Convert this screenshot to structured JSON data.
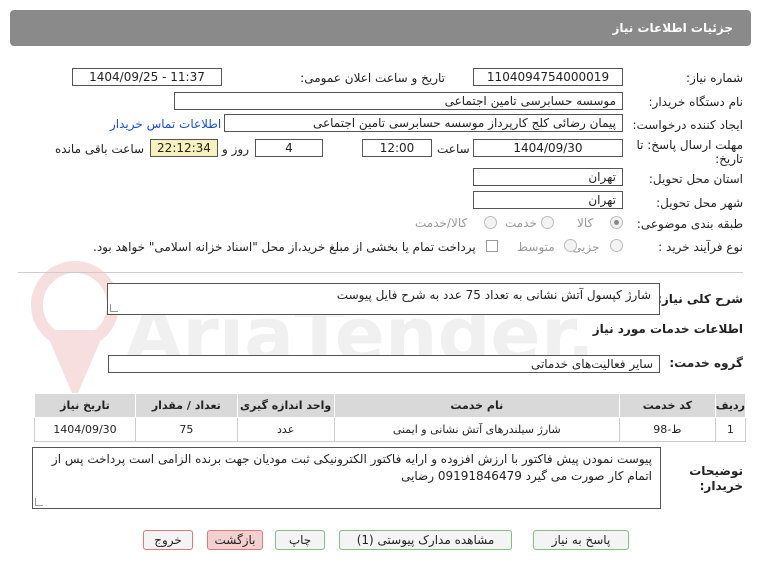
{
  "header": {
    "title": "جزئیات اطلاعات نیاز"
  },
  "form": {
    "need_number_label": "شماره نیاز:",
    "need_number": "1104094754000019",
    "announce_label": "تاریخ و ساعت اعلان عمومی:",
    "announce_value": "1404/09/25 - 11:37",
    "buyer_org_label": "نام دستگاه خریدار:",
    "buyer_org": "موسسه حسابرسی تامین اجتماعی",
    "requester_label": "ایجاد کننده درخواست:",
    "requester": "پیمان رضائی کلج کارپرداز موسسه حسابرسی تامین اجتماعی",
    "contact_link": "اطلاعات تماس خریدار",
    "deadline_label_1": "مهلت ارسال پاسخ: تا",
    "deadline_label_2": "تاریخ:",
    "deadline_date": "1404/09/30",
    "time_label": "ساعت",
    "deadline_time": "12:00",
    "days_value": "4",
    "days_label": "روز و",
    "remaining_time": "22:12:34",
    "remaining_label": "ساعت باقی مانده",
    "province_label": "استان محل تحویل:",
    "province": "تهران",
    "city_label": "شهر محل تحویل:",
    "city": "تهران",
    "category_label": "طبقه بندی موضوعی:",
    "category_options": [
      "کالا",
      "خدمت",
      "کالا/خدمت"
    ],
    "process_label": "نوع فرآیند خرید :",
    "process_options": [
      "جزیی",
      "متوسط"
    ],
    "payment_note": "پرداخت تمام یا بخشی از مبلغ خرید،از محل \"اسناد خزانه اسلامی\" خواهد بود."
  },
  "summary": {
    "label": "شرح کلی نیاز:",
    "text": "شارژ کپسول آتش نشانی به تعداد 75 عدد به شرح فایل پیوست"
  },
  "services_title": "اطلاعات خدمات مورد نیاز",
  "service_group": {
    "label": "گروه خدمت:",
    "value": "سایر فعالیت‌های خدماتی"
  },
  "table": {
    "headers": [
      "ردیف",
      "کد خدمت",
      "نام خدمت",
      "واحد اندازه گیری",
      "تعداد / مقدار",
      "تاریخ نیاز"
    ],
    "rows": [
      [
        "1",
        "ط-98",
        "شارژ سیلندرهای آتش نشانی و ایمنی",
        "عدد",
        "75",
        "1404/09/30"
      ]
    ]
  },
  "buyer_notes": {
    "label_1": "توضیحات",
    "label_2": "خریدار:",
    "text": "پیوست نمودن پیش فاکتور با ارزش افزوده و ارایه فاکتور الکترونیکی ثبت مودیان جهت برنده الزامی است پرداخت پس از اتمام کار صورت می گیرد 09191846479 رضایی"
  },
  "buttons": {
    "reply": "پاسخ به نیاز",
    "attachments": "مشاهده مدارک پیوستی (1)",
    "print": "چاپ",
    "back": "بازگشت",
    "exit": "خروج"
  },
  "watermark": {
    "text": "AriaTender.neT"
  }
}
